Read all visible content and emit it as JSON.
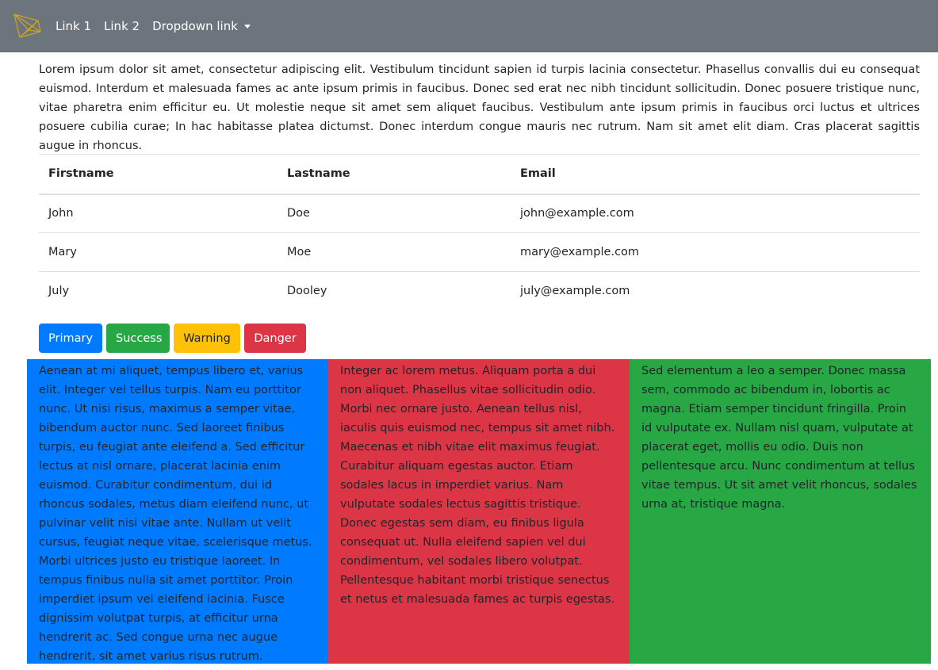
{
  "navbar": {
    "brand_icon": "logo-icon",
    "links": [
      "Link 1",
      "Link 2",
      "Dropdown link"
    ],
    "bg_color": "#6c757d"
  },
  "intro": "Lorem ipsum dolor sit amet, consectetur adipiscing elit. Vestibulum tincidunt sapien id turpis lacinia consectetur. Phasellus convallis dui eu consequat euismod. Interdum et malesuada fames ac ante ipsum primis in faucibus. Donec sed erat nec nibh tincidunt sollicitudin. Donec posuere tristique nunc, vitae pharetra enim efficitur eu. Ut molestie neque sit amet sem aliquet faucibus. Vestibulum ante ipsum primis in faucibus orci luctus et ultrices posuere cubilia curae; In hac habitasse platea dictumst. Donec interdum congue mauris nec rutrum. Nam sit amet elit diam. Cras placerat sagittis augue in rhoncus.",
  "table": {
    "headers": [
      "Firstname",
      "Lastname",
      "Email"
    ],
    "rows": [
      [
        "John",
        "Doe",
        "john@example.com"
      ],
      [
        "Mary",
        "Moe",
        "mary@example.com"
      ],
      [
        "July",
        "Dooley",
        "july@example.com"
      ]
    ]
  },
  "buttons": {
    "primary": "Primary",
    "success": "Success",
    "warning": "Warning",
    "danger": "Danger"
  },
  "columns": [
    "Aenean at mi aliquet, tempus libero et, varius elit. Integer vel tellus turpis. Nam eu porttitor nunc. Ut nisi risus, maximus a semper vitae, bibendum auctor nunc. Sed laoreet finibus turpis, eu feugiat ante eleifend a. Sed efficitur lectus at nisl ornare, placerat lacinia enim euismod. Curabitur condimentum, dui id rhoncus sodales, metus diam eleifend nunc, ut pulvinar velit nisi vitae ante. Nullam ut velit cursus, feugiat neque vitae, scelerisque metus. Morbi ultrices justo eu tristique laoreet. In tempus finibus nulla sit amet porttitor. Proin imperdiet ipsum vel eleifend lacinia. Fusce dignissim volutpat turpis, at efficitur urna hendrerit ac. Sed congue urna nec augue hendrerit, sit amet varius risus rutrum. Vestibulum et elit lectus.",
    "Integer ac lorem metus. Aliquam porta a dui non aliquet. Phasellus vitae sollicitudin odio. Morbi nec ornare justo. Aenean tellus nisl, iaculis quis euismod nec, tempus sit amet nibh. Maecenas et nibh vitae elit maximus feugiat. Curabitur aliquam egestas auctor. Etiam sodales lacus in imperdiet varius. Nam vulputate sodales lectus sagittis tristique. Donec egestas sem diam, eu finibus ligula consequat ut. Nulla eleifend sapien vel dui condimentum, vel sodales libero volutpat. Pellentesque habitant morbi tristique senectus et netus et malesuada fames ac turpis egestas.",
    "Sed elementum a leo a semper. Donec massa sem, commodo ac bibendum in, lobortis ac magna. Etiam semper tincidunt fringilla. Proin id vulputate ex. Nullam nisl quam, vulputate at placerat eget, mollis eu odio. Duis non pellentesque arcu. Nunc condimentum at tellus vitae tempus. Ut sit amet velit rhoncus, sodales urna at, tristique magna."
  ],
  "colors": {
    "primary": "#007bff",
    "success": "#28a745",
    "warning": "#ffc107",
    "danger": "#dc3545"
  }
}
